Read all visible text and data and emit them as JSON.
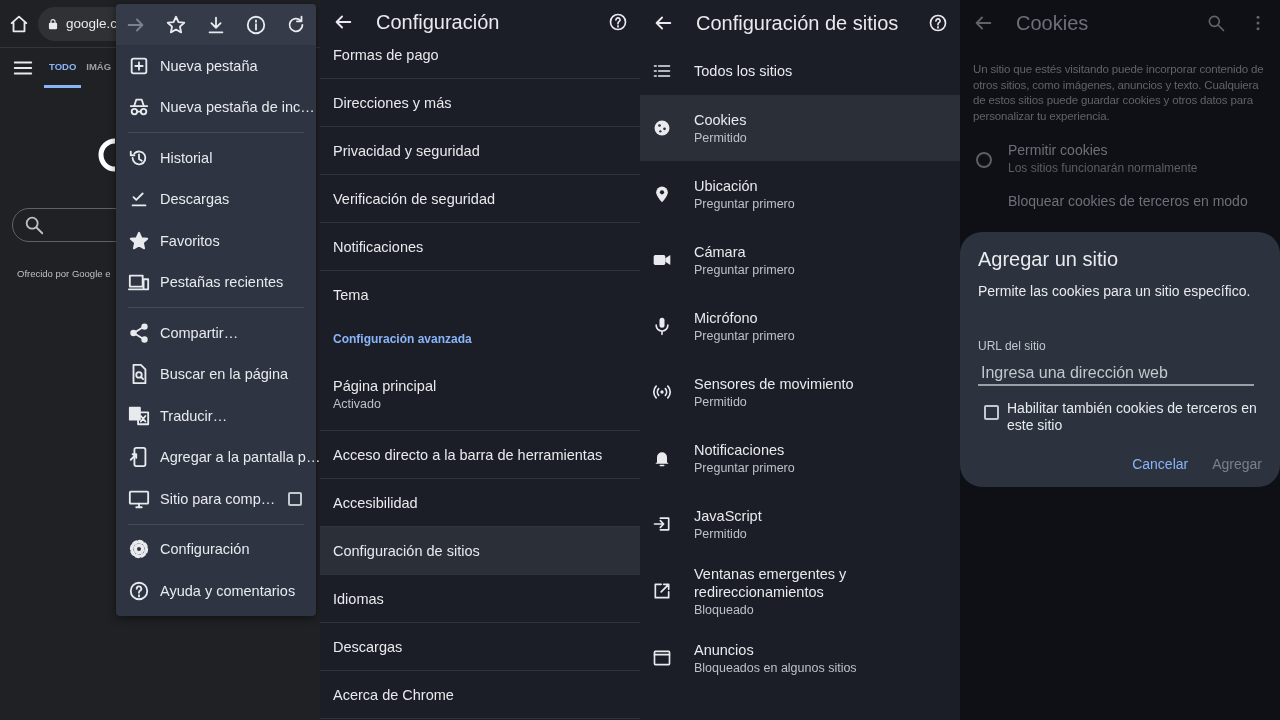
{
  "browser": {
    "url": "google.c",
    "tabs": [
      {
        "label": "TODO",
        "selected": true
      },
      {
        "label": "IMÁG",
        "selected": false
      }
    ],
    "footer_text": "Ofrecido por Google e",
    "menu": {
      "toolbar": [
        {
          "disabled": true
        },
        {
          "disabled": false
        },
        {
          "disabled": false
        },
        {
          "disabled": false
        },
        {
          "disabled": false
        }
      ],
      "sections": [
        [
          {
            "label": "Nueva pestaña",
            "kind": "action"
          },
          {
            "label": "Nueva pestaña de inc…",
            "kind": "action"
          }
        ],
        [
          {
            "label": "Historial",
            "kind": "action"
          },
          {
            "label": "Descargas",
            "kind": "action"
          },
          {
            "label": "Favoritos",
            "kind": "action"
          },
          {
            "label": "Pestañas recientes",
            "kind": "action"
          }
        ],
        [
          {
            "label": "Compartir…",
            "kind": "action"
          },
          {
            "label": "Buscar en la página",
            "kind": "action"
          },
          {
            "label": "Traducir…",
            "kind": "action"
          },
          {
            "label": "Agregar a la pantalla p…",
            "kind": "action"
          },
          {
            "label": "Sitio para comp…",
            "kind": "checkbox",
            "checked": false
          }
        ],
        [
          {
            "label": "Configuración",
            "kind": "action"
          },
          {
            "label": "Ayuda y comentarios",
            "kind": "action"
          }
        ]
      ]
    }
  },
  "settings": {
    "title": "Configuración",
    "items": [
      {
        "kind": "item",
        "title": "Formas de pago",
        "selected": false
      },
      {
        "kind": "item",
        "title": "Direcciones y más",
        "selected": false
      },
      {
        "kind": "item",
        "title": "Privacidad y seguridad",
        "selected": false
      },
      {
        "kind": "item",
        "title": "Verificación de seguridad",
        "selected": false
      },
      {
        "kind": "item",
        "title": "Notificaciones",
        "selected": false
      },
      {
        "kind": "item",
        "title": "Tema",
        "selected": false
      },
      {
        "kind": "section",
        "title": "Configuración avanzada"
      },
      {
        "kind": "item",
        "title": "Página principal",
        "subtitle": "Activado",
        "selected": false
      },
      {
        "kind": "item",
        "title": "Acceso directo a la barra de herramientas",
        "selected": false
      },
      {
        "kind": "item",
        "title": "Accesibilidad",
        "selected": false
      },
      {
        "kind": "item",
        "title": "Configuración de sitios",
        "selected": true
      },
      {
        "kind": "item",
        "title": "Idiomas",
        "selected": false
      },
      {
        "kind": "item",
        "title": "Descargas",
        "selected": false
      },
      {
        "kind": "item",
        "title": "Acerca de Chrome",
        "selected": false
      }
    ]
  },
  "site_settings": {
    "title": "Configuración de sitios",
    "items": [
      {
        "title": "Todos los sitios",
        "selected": false
      },
      {
        "title": "Cookies",
        "subtitle": "Permitido",
        "selected": true
      },
      {
        "title": "Ubicación",
        "subtitle": "Preguntar primero",
        "selected": false
      },
      {
        "title": "Cámara",
        "subtitle": "Preguntar primero",
        "selected": false
      },
      {
        "title": "Micrófono",
        "subtitle": "Preguntar primero",
        "selected": false
      },
      {
        "title": "Sensores de movimiento",
        "subtitle": "Permitido",
        "selected": false
      },
      {
        "title": "Notificaciones",
        "subtitle": "Preguntar primero",
        "selected": false
      },
      {
        "title": "JavaScript",
        "subtitle": "Permitido",
        "selected": false
      },
      {
        "title": "Ventanas emergentes y redireccionamientos",
        "subtitle": "Bloqueado",
        "selected": false
      },
      {
        "title": "Anuncios",
        "subtitle": "Bloqueados en algunos sitios",
        "selected": false
      }
    ]
  },
  "cookies": {
    "title": "Cookies",
    "description": "Un sitio que estés visitando puede incorporar contenido de otros sitios, como imágenes, anuncios y texto. Cualquiera de estos sitios puede guardar cookies y otros datos para personalizar tu experiencia.",
    "options": [
      {
        "title": "Permitir cookies",
        "subtitle": "Los sitios funcionarán normalmente",
        "selected": false
      },
      {
        "title": "Bloquear cookies de terceros en modo"
      }
    ],
    "dialog": {
      "title": "Agregar un sitio",
      "message": "Permite las cookies para un sitio específico.",
      "field_label": "URL del sitio",
      "placeholder": "Ingresa una dirección web",
      "checkbox": {
        "label": "Habilitar también cookies de terceros en este sitio",
        "checked": false
      },
      "buttons": [
        {
          "label": "Cancelar",
          "disabled": false
        },
        {
          "label": "Agregar",
          "disabled": true
        }
      ]
    }
  }
}
